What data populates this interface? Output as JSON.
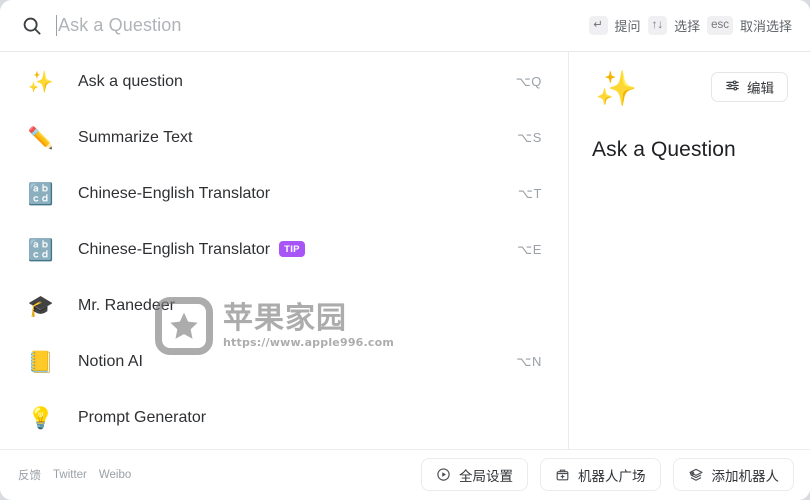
{
  "search": {
    "icon": "search-icon",
    "placeholder": "Ask a Question",
    "value": ""
  },
  "hints": [
    {
      "key": "↵",
      "label": "提问"
    },
    {
      "key": "↑↓",
      "label": "选择"
    },
    {
      "key": "esc",
      "label": "取消选择"
    }
  ],
  "list": {
    "items": [
      {
        "icon": "✨",
        "icon_name": "sparkles-icon",
        "label": "Ask a question",
        "shortcut": "⌥Q",
        "badge": ""
      },
      {
        "icon": "✏️",
        "icon_name": "pencil-icon",
        "label": "Summarize Text",
        "shortcut": "⌥S",
        "badge": ""
      },
      {
        "icon": "🔡",
        "icon_name": "abc-icon",
        "label": "Chinese-English Translator",
        "shortcut": "⌥T",
        "badge": ""
      },
      {
        "icon": "🔡",
        "icon_name": "abc-icon",
        "label": "Chinese-English Translator",
        "shortcut": "⌥E",
        "badge": "TIP"
      },
      {
        "icon": "🎓",
        "icon_name": "graduation-cap-icon",
        "label": "Mr. Ranedeer",
        "shortcut": "",
        "badge": ""
      },
      {
        "icon": "📒",
        "icon_name": "notebook-icon",
        "label": "Notion AI",
        "shortcut": "⌥N",
        "badge": ""
      },
      {
        "icon": "💡",
        "icon_name": "lightbulb-icon",
        "label": "Prompt Generator",
        "shortcut": "",
        "badge": ""
      }
    ]
  },
  "detail": {
    "emoji": "✨",
    "emoji_name": "sparkles-icon",
    "title": "Ask a Question",
    "edit_label": "编辑"
  },
  "footer": {
    "links": [
      {
        "label": "反馈"
      },
      {
        "label": "Twitter"
      },
      {
        "label": "Weibo"
      }
    ],
    "buttons": [
      {
        "label": "全局设置",
        "icon_name": "settings-play-icon"
      },
      {
        "label": "机器人广场",
        "icon_name": "robot-store-icon"
      },
      {
        "label": "添加机器人",
        "icon_name": "add-robot-icon"
      }
    ]
  },
  "watermark": {
    "title": "苹果家园",
    "url": "https://www.apple996.com"
  },
  "colors": {
    "badge_purple": "#a855f7",
    "text_primary": "#2e3033",
    "text_muted": "#9aa0a6"
  }
}
